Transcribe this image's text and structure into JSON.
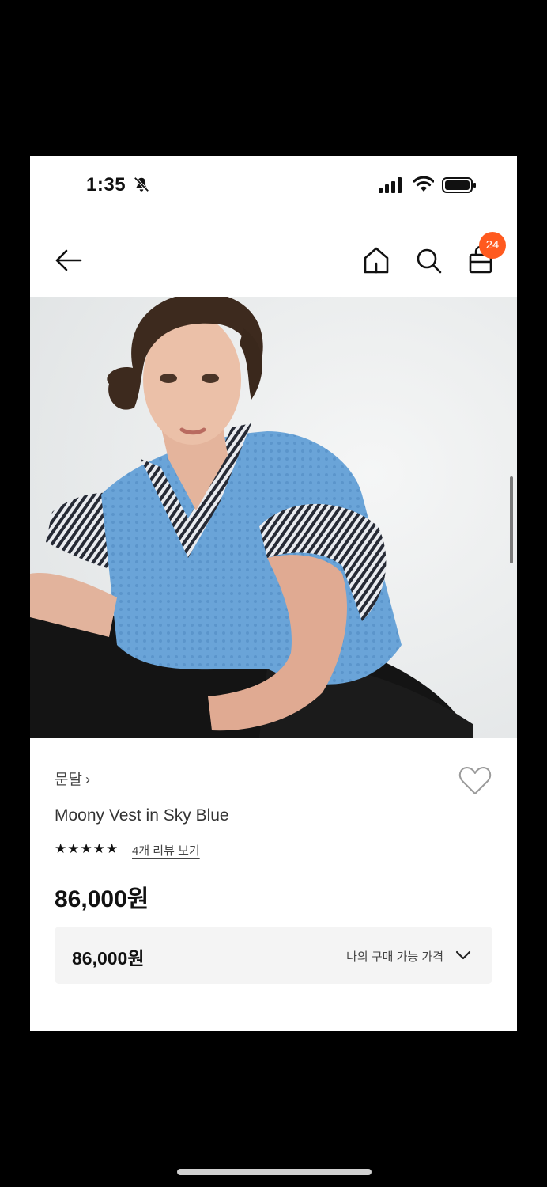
{
  "status_bar": {
    "time": "1:35",
    "icons": [
      "bell-slash-icon",
      "signal-icon",
      "wifi-icon",
      "battery-icon"
    ]
  },
  "nav": {
    "back_icon": "arrow-left-icon",
    "home_icon": "home-icon",
    "search_icon": "search-icon",
    "bag_icon": "shopping-bag-icon",
    "cart_count": "24",
    "badge_color": "#ff5a1f"
  },
  "product": {
    "image_alt": "model wearing knit vest over striped shirt",
    "brand": "문달",
    "brand_chevron": "›",
    "name": "Moony Vest in Sky Blue",
    "rating_stars": 5,
    "star_glyph": "★",
    "review_link": "4개 리뷰 보기",
    "price": "86,000원",
    "wishlist_icon": "heart-outline-icon"
  },
  "purchase_price": {
    "value": "86,000원",
    "label": "나의 구매 가능 가격",
    "chevron_icon": "chevron-down-icon"
  }
}
